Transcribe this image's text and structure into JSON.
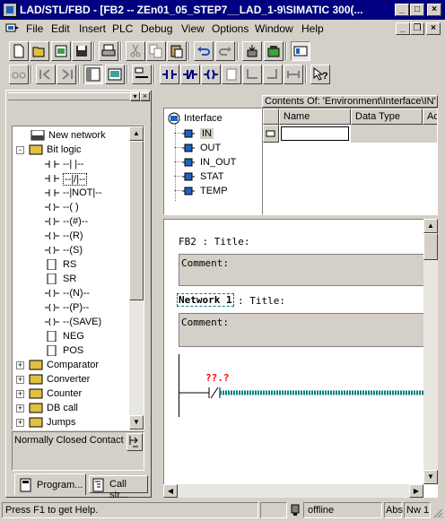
{
  "window": {
    "title": "LAD/STL/FBD  - [FB2 -- ZEn01_05_STEP7__LAD_1-9\\SIMATIC 300(...",
    "min": "_",
    "max": "□",
    "close": "×"
  },
  "menu": {
    "items": [
      "File",
      "Edit",
      "Insert",
      "PLC",
      "Debug",
      "View",
      "Options",
      "Window",
      "Help"
    ],
    "mdi_min": "_",
    "mdi_restore": "❐",
    "mdi_close": "×"
  },
  "tree": {
    "items": [
      {
        "label": "New network",
        "indent": 1,
        "expander": ""
      },
      {
        "label": "Bit logic",
        "indent": 0,
        "expander": "-"
      },
      {
        "label": "--| |--",
        "indent": 2,
        "expander": ""
      },
      {
        "label": "--|/|--",
        "indent": 2,
        "expander": "",
        "selected": true
      },
      {
        "label": "--|NOT|--",
        "indent": 2,
        "expander": ""
      },
      {
        "label": "--( )",
        "indent": 2,
        "expander": ""
      },
      {
        "label": "--(#)--",
        "indent": 2,
        "expander": ""
      },
      {
        "label": "--(R)",
        "indent": 2,
        "expander": ""
      },
      {
        "label": "--(S)",
        "indent": 2,
        "expander": ""
      },
      {
        "label": "RS",
        "indent": 2,
        "expander": ""
      },
      {
        "label": "SR",
        "indent": 2,
        "expander": ""
      },
      {
        "label": "--(N)--",
        "indent": 2,
        "expander": ""
      },
      {
        "label": "--(P)--",
        "indent": 2,
        "expander": ""
      },
      {
        "label": "--(SAVE)",
        "indent": 2,
        "expander": ""
      },
      {
        "label": "NEG",
        "indent": 2,
        "expander": ""
      },
      {
        "label": "POS",
        "indent": 2,
        "expander": ""
      },
      {
        "label": "Comparator",
        "indent": 0,
        "expander": "+"
      },
      {
        "label": "Converter",
        "indent": 0,
        "expander": "+"
      },
      {
        "label": "Counter",
        "indent": 0,
        "expander": "+"
      },
      {
        "label": "DB call",
        "indent": 0,
        "expander": "+"
      },
      {
        "label": "Jumps",
        "indent": 0,
        "expander": "+"
      }
    ],
    "description": "Normally Closed Contact",
    "tabs": [
      "Program...",
      "Call str..."
    ]
  },
  "interface": {
    "root": "Interface",
    "items": [
      "IN",
      "OUT",
      "IN_OUT",
      "STAT",
      "TEMP"
    ],
    "contents_title": "Contents Of: 'Environment\\Interface\\IN'",
    "columns": [
      "Name",
      "Data Type",
      "Ac"
    ]
  },
  "editor": {
    "block_title": "FB2 : Title:",
    "comment_label": "Comment:",
    "network_label": "Network 1",
    "network_title": ": Title:",
    "network_comment": "Comment:",
    "contact_address": "??.?"
  },
  "status": {
    "help": "Press F1 to get Help.",
    "mode": "offline",
    "abs": "Abs",
    "network": "Nw 1"
  },
  "colors": {
    "titlebar": "#000080",
    "contact_address": "#ff0000",
    "rung": "#008080"
  }
}
